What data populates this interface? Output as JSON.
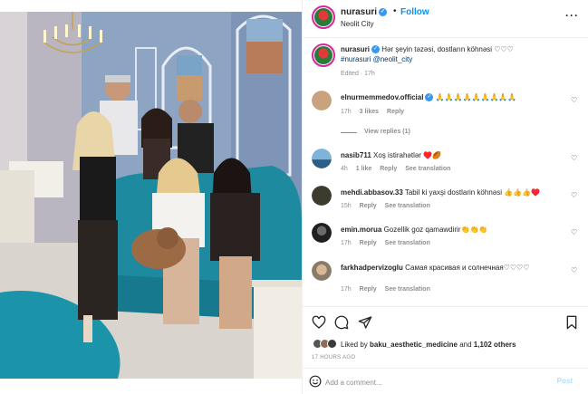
{
  "post": {
    "author": "nurasuri",
    "follow_label": "Follow",
    "location": "Neolit City",
    "more_glyph": "···",
    "caption": "Hər şeyin təzəsi, dostların köhnəsi ♡♡♡",
    "caption_tags": "#nurasuri @neolit_city",
    "caption_meta": "Edited · 17h",
    "likes": {
      "prefix": "Liked by",
      "user": "baku_aesthetic_medicine",
      "joiner": "and",
      "others": "1,102 others"
    },
    "time_ago": "17 HOURS AGO"
  },
  "comments": [
    {
      "user": "elnurmemmedov.official",
      "verified": true,
      "text": "🙏🙏🙏🙏🙏🙏🙏🙏🙏",
      "age": "17h",
      "likes": "3 likes",
      "reply": "Reply",
      "translate": "",
      "view_replies": "View replies (1)",
      "avatar_color": "#c9a27e"
    },
    {
      "user": "nasib711",
      "verified": false,
      "text": "Xoş istirahətlər ♥️🏉",
      "age": "4h",
      "likes": "1 like",
      "reply": "Reply",
      "translate": "See translation",
      "view_replies": "",
      "avatar_color": "#4a7fa8"
    },
    {
      "user": "mehdi.abbasov.33",
      "verified": false,
      "text": "Tabil ki yaxşi dostlarin köhnəsi 👍👍👍♥️",
      "age": "15h",
      "likes": "",
      "reply": "Reply",
      "translate": "See translation",
      "view_replies": "",
      "avatar_color": "#3d3a2e"
    },
    {
      "user": "emin.morua",
      "verified": false,
      "text": "Gozellik goz qamawdirir👏👏👏",
      "age": "17h",
      "likes": "",
      "reply": "Reply",
      "translate": "See translation",
      "view_replies": "",
      "avatar_color": "#2b2b2b"
    },
    {
      "user": "farkhadpervizoglu",
      "verified": false,
      "text": "Самая красивая и солнечная♡♡♡♡",
      "age": "17h",
      "likes": "",
      "reply": "Reply",
      "translate": "See translation",
      "view_replies": "",
      "avatar_color": "#8a7a68"
    }
  ],
  "comment_box": {
    "placeholder": "Add a comment...",
    "post_label": "Post"
  },
  "colors": {
    "accent": "#0095f6",
    "post_disabled": "#b2dffc",
    "verified": "#3897f0",
    "sofa_teal": "#1d8aa0"
  },
  "icons": {
    "like": "heart-icon",
    "comment": "comment-icon",
    "share": "paper-plane-icon",
    "save": "bookmark-icon",
    "emoji": "smiley-icon",
    "more": "more-dots-icon",
    "comment_like": "heart-outline-icon"
  }
}
